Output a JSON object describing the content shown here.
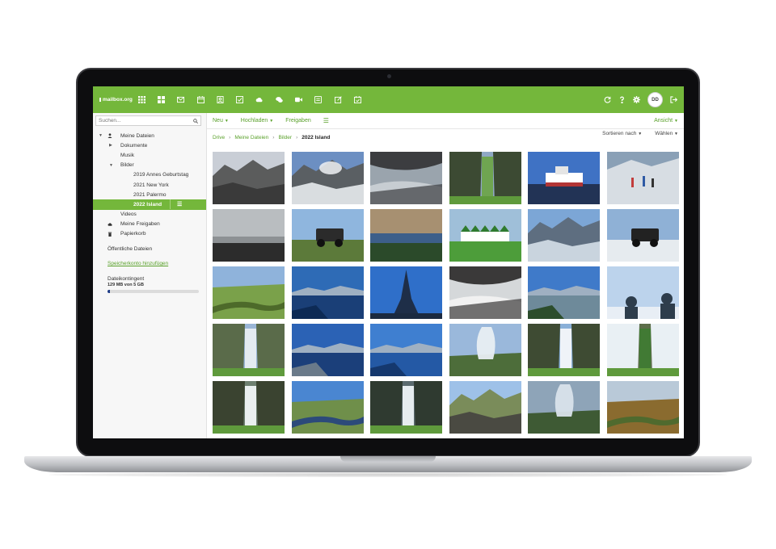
{
  "app": {
    "logo_text": "mailbox.org",
    "avatar_initials": "DD",
    "accent": "#74b73b"
  },
  "topbar_apps": [
    "grid-icon",
    "dashboard-icon",
    "mail-icon",
    "calendar-icon",
    "contacts-icon",
    "tasks-icon",
    "cloud-icon",
    "chat-icon",
    "video-icon",
    "notes-icon",
    "edit-icon",
    "calendar-check-icon"
  ],
  "topbar_right": [
    "refresh-icon",
    "help-icon",
    "settings-icon",
    "avatar",
    "logout-icon"
  ],
  "sidebar": {
    "search_placeholder": "Suchen...",
    "tree": [
      {
        "label": "Meine Dateien",
        "level": 0,
        "caret": "▾",
        "icon": "user-icon"
      },
      {
        "label": "Dokumente",
        "level": 1,
        "caret": "▸"
      },
      {
        "label": "Musik",
        "level": 1
      },
      {
        "label": "Bilder",
        "level": 1,
        "caret": "▾"
      },
      {
        "label": "2019 Annes Geburtstag",
        "level": 2
      },
      {
        "label": "2021 New York",
        "level": 2
      },
      {
        "label": "2021 Palermo",
        "level": 2
      },
      {
        "label": "2022 Island",
        "level": 2,
        "selected": true
      },
      {
        "label": "Videos",
        "level": 1
      },
      {
        "label": "Meine Freigaben",
        "level": 0,
        "icon": "cloud-icon"
      },
      {
        "label": "Papierkorb",
        "level": 0,
        "icon": "trash-icon"
      }
    ],
    "public_files": "Öffentliche Dateien",
    "add_storage": "Speicherkonto hinzufügen",
    "quota_title": "Dateikontingent",
    "quota_detail": "129 MB von 5 GB",
    "quota_fraction": 0.025
  },
  "toolbar": {
    "new": "Neu",
    "upload": "Hochladen",
    "shares": "Freigaben",
    "view": "Ansicht"
  },
  "breadcrumb": {
    "items": [
      "Drive",
      "Meine Dateien",
      "Bilder"
    ],
    "current": "2022 Island",
    "sort": "Sortieren nach",
    "select": "Wählen"
  },
  "photos": [
    "glacier-mountain",
    "steaming-volcano",
    "cave-people",
    "waterfall-cliff",
    "harbor-ship",
    "snow-hikers",
    "grey-beach",
    "jeep-field",
    "sunset-coast",
    "green-houses",
    "blue-mountains",
    "jeep-snow",
    "valley-river",
    "blue-lake",
    "hallgrimskirkja",
    "lava-rock",
    "lagoon-shore",
    "people-sky",
    "canyon-waterfall",
    "blue-fjord",
    "calm-sea",
    "geyser",
    "double-waterfall",
    "mist-waterfall",
    "skogafoss",
    "river-coast",
    "seljalandsfoss",
    "lava-field",
    "gullfoss",
    "canyon-gold"
  ]
}
